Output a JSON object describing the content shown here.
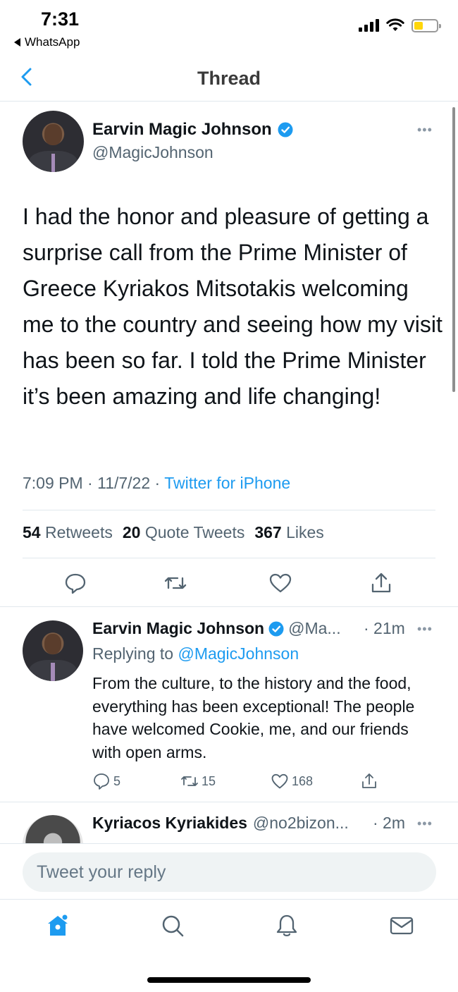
{
  "status_bar": {
    "time": "7:31",
    "back_app": "WhatsApp",
    "battery_color": "#ffd60a"
  },
  "nav": {
    "title": "Thread",
    "back_icon": "chevron-left-icon"
  },
  "main_tweet": {
    "author_name": "Earvin Magic Johnson",
    "handle": "@MagicJohnson",
    "verified": true,
    "text": "I had the honor and pleasure of getting a surprise call from the Prime Minister of Greece Kyriakos Mitsotakis welcoming me to the country and seeing how my visit has been so far. I told the Prime Minister it’s been amazing and life changing!",
    "time": "7:09 PM",
    "date": "11/7/22",
    "meta_sep": "·",
    "source": "Twitter for iPhone",
    "stats": {
      "retweets_count": "54",
      "retweets_label": "Retweets",
      "quotes_count": "20",
      "quotes_label": "Quote Tweets",
      "likes_count": "367",
      "likes_label": "Likes"
    },
    "more_label": "•••"
  },
  "reply_tweet": {
    "author_name": "Earvin Magic Johnson",
    "handle": "@Ma...",
    "time": "· 21m",
    "replying_prefix": "Replying to",
    "replying_to": "@MagicJohnson",
    "text": "From the culture, to the history and the food, everything has been exceptional! The people have welcomed Cookie, me, and our friends with open arms.",
    "reply_count": "5",
    "retweet_count": "15",
    "like_count": "168",
    "more_label": "•••"
  },
  "third_tweet": {
    "author_name": "Kyriacos Kyriakides",
    "handle": "@no2bizon...",
    "time": "· 2m",
    "more_label": "•••"
  },
  "reply_bar": {
    "placeholder": "Tweet your reply"
  },
  "tab_bar": {
    "items": [
      "home-icon",
      "search-icon",
      "notifications-icon",
      "messages-icon"
    ],
    "active_color": "#1d9bf0"
  },
  "colors": {
    "accent": "#1d9bf0",
    "secondary_text": "#536471"
  }
}
